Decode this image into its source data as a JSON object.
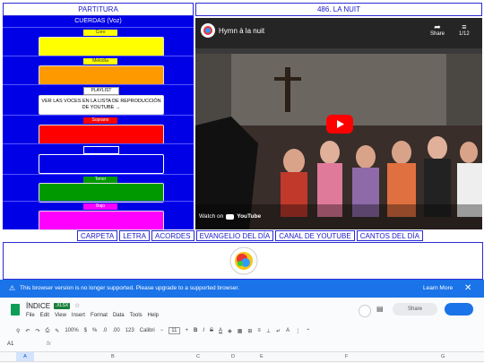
{
  "header": {
    "partitura": "PARTITURA",
    "song": "486. LA NUIT"
  },
  "voices_title": "CUERDAS (Voz)",
  "voices": [
    {
      "tag": "Coro",
      "color": "#ffff00"
    },
    {
      "tag": "Melodía",
      "color": "#ff9900"
    },
    {
      "tag": "PLAYLIST",
      "color": "#ffffff"
    },
    {
      "tag": "Soprano",
      "color": "#ff0000"
    },
    {
      "tag": "",
      "color": "#0000e6"
    },
    {
      "tag": "Tenor",
      "color": "#009900"
    },
    {
      "tag": "Bajo",
      "color": "#ff00ff"
    }
  ],
  "playlist_text": "VER LAS VOCES EN LA LISTA DE REPRODUCCIÓN DE YOUTUBE →",
  "video": {
    "title": "Hymn à la nuit",
    "share": "Share",
    "count": "1/12",
    "watch_on": "Watch on",
    "youtube": "YouTube"
  },
  "nav": [
    "CARPETA",
    "LETRA",
    "ACORDES",
    "EVANGELIO DEL DÍA",
    "CANAL DE YOUTUBE",
    "CANTOS DEL DÍA"
  ],
  "banner": {
    "text": "This browser version is no longer supported. Please upgrade to a supported browser.",
    "learn": "Learn More"
  },
  "sheets": {
    "title": "ÍNDICE",
    "badge": ".XLSX",
    "menus": [
      "File",
      "Edit",
      "View",
      "Insert",
      "Format",
      "Data",
      "Tools",
      "Help"
    ],
    "share": "Share",
    "zoom": "100%",
    "font": "Calibri",
    "font_size": "11",
    "fmt": [
      "$",
      "%",
      ".0",
      ".00",
      "123"
    ],
    "cell_ref": "A1",
    "fx": "fx",
    "cols": [
      "A",
      "B",
      "C",
      "D",
      "E",
      "F",
      "G"
    ]
  }
}
